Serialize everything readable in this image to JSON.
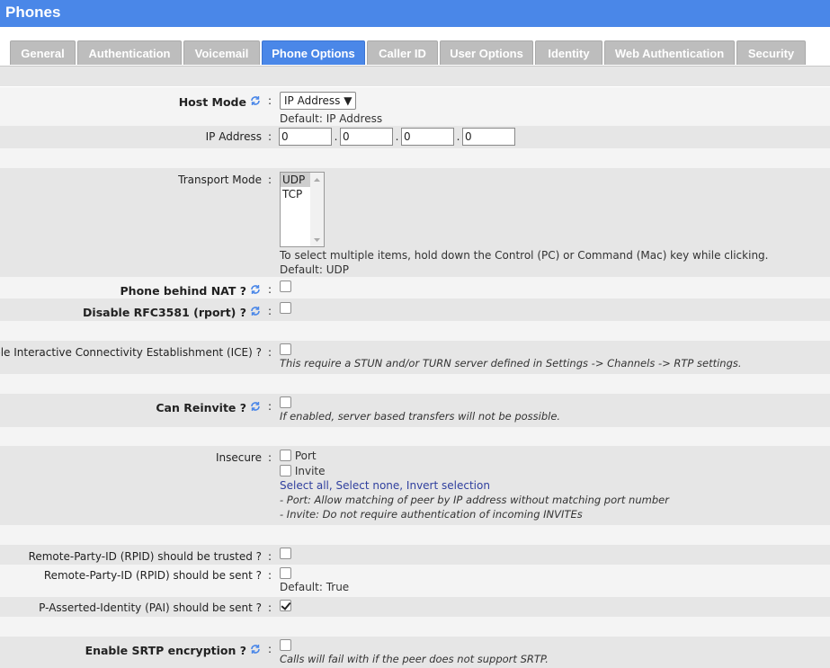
{
  "page": {
    "title": "Phones"
  },
  "tabs": [
    {
      "label": "General"
    },
    {
      "label": "Authentication"
    },
    {
      "label": "Voicemail"
    },
    {
      "label": "Phone Options"
    },
    {
      "label": "Caller ID"
    },
    {
      "label": "User Options"
    },
    {
      "label": "Identity"
    },
    {
      "label": "Web Authentication"
    },
    {
      "label": "Security"
    }
  ],
  "active_tab": "Phone Options",
  "colon": ":",
  "host_mode": {
    "label": "Host Mode",
    "value": "IP Address",
    "default": "Default: IP Address"
  },
  "ip_address": {
    "label": "IP Address",
    "octets": [
      "0",
      "0",
      "0",
      "0"
    ],
    "separator": "."
  },
  "transport_mode": {
    "label": "Transport Mode",
    "options": [
      "UDP",
      "TCP"
    ],
    "selected": "UDP",
    "help": "To select multiple items, hold down the Control (PC) or Command (Mac) key while clicking.",
    "default": "Default: UDP"
  },
  "phone_behind_nat": {
    "label": "Phone behind NAT ?",
    "checked": false
  },
  "disable_rfc3581": {
    "label": "Disable RFC3581 (rport) ?",
    "checked": false
  },
  "ice": {
    "label": "Enable Interactive Connectivity Establishment (ICE) ?",
    "checked": false,
    "help": "This require a STUN and/or TURN server defined in Settings -> Channels -> RTP settings."
  },
  "can_reinvite": {
    "label": "Can Reinvite ?",
    "checked": false,
    "help": "If enabled, server based transfers will not be possible."
  },
  "insecure": {
    "label": "Insecure",
    "options": [
      {
        "label": "Port",
        "checked": false
      },
      {
        "label": "Invite",
        "checked": false
      }
    ],
    "select_all": "Select all",
    "select_none": "Select none",
    "invert": "Invert selection",
    "link_sep": ", ",
    "help_port": "- Port: Allow matching of peer by IP address without matching port number",
    "help_invite": "- Invite: Do not require authentication of incoming INVITEs"
  },
  "rpid_trusted": {
    "label": "Remote-Party-ID (RPID) should be trusted ?",
    "checked": false
  },
  "rpid_sent": {
    "label": "Remote-Party-ID (RPID) should be sent ?",
    "checked": false,
    "default": "Default: True"
  },
  "pai_sent": {
    "label": "P-Asserted-Identity (PAI) should be sent ?",
    "checked": true
  },
  "srtp": {
    "label": "Enable SRTP encryption ?",
    "checked": false,
    "help": "Calls will fail with if the peer does not support SRTP."
  },
  "icons": {
    "sync": "sync-icon",
    "dropdown": "caret-down-icon"
  },
  "colors": {
    "accent": "#4a87e8",
    "tab_inactive": "#bdbdbd",
    "row_gray": "#e6e6e6",
    "row_light": "#f4f4f4",
    "sync_icon": "#4a87e8",
    "link": "#2f3f9e"
  }
}
